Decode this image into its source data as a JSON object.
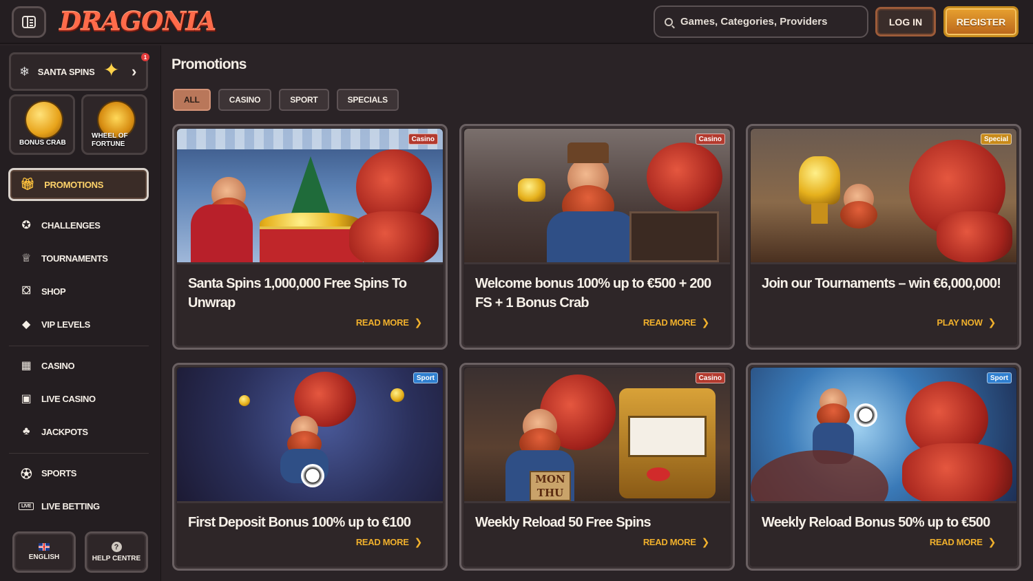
{
  "header": {
    "logo": "DRAGONIA",
    "search_placeholder": "Games, Categories, Providers",
    "login_label": "LOG IN",
    "register_label": "REGISTER"
  },
  "sidebar": {
    "santa_spins": {
      "label": "SANTA SPINS",
      "notification_count": "1"
    },
    "tiles": [
      {
        "label_line1": "BONUS CRAB",
        "label_line2": ""
      },
      {
        "label_line1": "WHEEL OF",
        "label_line2": "FORTUNE"
      }
    ],
    "active_item": "PROMOTIONS",
    "items_group1": [
      {
        "label": "CHALLENGES",
        "icon": "challenge-icon"
      },
      {
        "label": "TOURNAMENTS",
        "icon": "trophy-icon"
      },
      {
        "label": "SHOP",
        "icon": "shop-bag-icon"
      },
      {
        "label": "VIP LEVELS",
        "icon": "diamond-icon"
      }
    ],
    "items_group2": [
      {
        "label": "CASINO",
        "icon": "slot-machine-icon"
      },
      {
        "label": "LIVE CASINO",
        "icon": "live-card-icon"
      },
      {
        "label": "JACKPOTS",
        "icon": "clover-icon"
      }
    ],
    "items_group3": [
      {
        "label": "SPORTS",
        "icon": "ball-icon"
      },
      {
        "label": "LIVE BETTING",
        "icon": "live-tag-icon",
        "tag": "LIVE"
      }
    ],
    "footer": {
      "language": "ENGLISH",
      "help": "HELP CENTRE",
      "help_glyph": "?"
    }
  },
  "main": {
    "title": "Promotions",
    "filters": [
      "ALL",
      "CASINO",
      "SPORT",
      "SPECIALS"
    ],
    "active_filter": "ALL",
    "cards": [
      {
        "badge": "Casino",
        "badge_color": "#b33a2e",
        "title": "Santa Spins 1,000,000 Free Spins To Unwrap",
        "cta": "READ MORE"
      },
      {
        "badge": "Casino",
        "badge_color": "#b33a2e",
        "title": "Welcome bonus 100% up to €500 + 200 FS + 1 Bonus Crab",
        "cta": "READ MORE"
      },
      {
        "badge": "Special",
        "badge_color": "#c88a1a",
        "title": "Join our Tournaments – win €6,000,000!",
        "cta": "PLAY NOW"
      },
      {
        "badge": "Sport",
        "badge_color": "#2f7fd0",
        "title": "First Deposit Bonus 100% up to €100",
        "cta": "READ MORE"
      },
      {
        "badge": "Casino",
        "badge_color": "#b33a2e",
        "title": "Weekly Reload 50 Free Spins",
        "cta": "READ MORE"
      },
      {
        "badge": "Sport",
        "badge_color": "#2f7fd0",
        "title": "Weekly Reload Bonus 50% up to €500",
        "cta": "READ MORE"
      }
    ],
    "card4_art_text_1": "MON",
    "card4_art_text_2": "THU"
  },
  "colors": {
    "background": "#2a2326",
    "accent_gold": "#f0b02c",
    "active_filter": "#b9775a",
    "logo_red": "#ff6b4a"
  }
}
